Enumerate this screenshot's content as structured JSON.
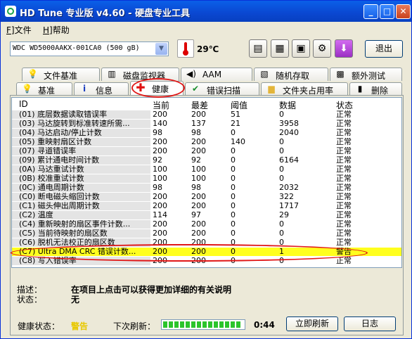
{
  "window": {
    "title": "HD Tune 专业版 v4.60 - 硬盘专业工具"
  },
  "menu": [
    {
      "label": "文件"
    },
    {
      "label": "帮助"
    }
  ],
  "toolbar": {
    "drive": "WDC WD5000AAKX-001CA0 (500 gB)",
    "temperature": "29℃",
    "exit_label": "退出"
  },
  "tabs_row1": [
    {
      "label": "文件基准",
      "icon": "light-bulb-doc-icon"
    },
    {
      "label": "磁盘监视器",
      "icon": "bar-chart-icon"
    },
    {
      "label": "AAM",
      "icon": "speaker-icon"
    },
    {
      "label": "随机存取",
      "icon": "random-access-icon"
    },
    {
      "label": "额外测试",
      "icon": "extra-tests-icon"
    }
  ],
  "tabs_row2": [
    {
      "label": "基准",
      "icon": "bulb-icon"
    },
    {
      "label": "信息",
      "icon": "info-icon"
    },
    {
      "label": "健康",
      "icon": "health-cross-icon"
    },
    {
      "label": "错误扫描",
      "icon": "check-icon"
    },
    {
      "label": "文件夹占用率",
      "icon": "folder-icon"
    },
    {
      "label": "删除",
      "icon": "trash-icon"
    }
  ],
  "smart_table": {
    "columns": [
      "ID",
      "当前",
      "最差",
      "阈值",
      "数据",
      "状态"
    ],
    "rows": [
      {
        "id": "(01) 底层数据读取错误率",
        "current": "200",
        "worst": "200",
        "threshold": "51",
        "data": "0",
        "status": "正常"
      },
      {
        "id": "(03) 马达旋转到标准转速所需...",
        "current": "140",
        "worst": "137",
        "threshold": "21",
        "data": "3958",
        "status": "正常"
      },
      {
        "id": "(04) 马达启动/停止计数",
        "current": "98",
        "worst": "98",
        "threshold": "0",
        "data": "2040",
        "status": "正常"
      },
      {
        "id": "(05) 重映射扇区计数",
        "current": "200",
        "worst": "200",
        "threshold": "140",
        "data": "0",
        "status": "正常"
      },
      {
        "id": "(07) 寻道错误率",
        "current": "200",
        "worst": "200",
        "threshold": "0",
        "data": "0",
        "status": "正常"
      },
      {
        "id": "(09) 累计通电时间计数",
        "current": "92",
        "worst": "92",
        "threshold": "0",
        "data": "6164",
        "status": "正常"
      },
      {
        "id": "(0A) 马达重试计数",
        "current": "100",
        "worst": "100",
        "threshold": "0",
        "data": "0",
        "status": "正常"
      },
      {
        "id": "(0B) 校准重试计数",
        "current": "100",
        "worst": "100",
        "threshold": "0",
        "data": "0",
        "status": "正常"
      },
      {
        "id": "(0C) 通电周期计数",
        "current": "98",
        "worst": "98",
        "threshold": "0",
        "data": "2032",
        "status": "正常"
      },
      {
        "id": "(C0) 断电磁头缩回计数",
        "current": "200",
        "worst": "200",
        "threshold": "0",
        "data": "322",
        "status": "正常"
      },
      {
        "id": "(C1) 磁头伸出周期计数",
        "current": "200",
        "worst": "200",
        "threshold": "0",
        "data": "1717",
        "status": "正常"
      },
      {
        "id": "(C2) 温度",
        "current": "114",
        "worst": "97",
        "threshold": "0",
        "data": "29",
        "status": "正常"
      },
      {
        "id": "(C4) 重新映射的扇区事件计数...",
        "current": "200",
        "worst": "200",
        "threshold": "0",
        "data": "0",
        "status": "正常"
      },
      {
        "id": "(C5) 当前待映射的扇区数",
        "current": "200",
        "worst": "200",
        "threshold": "0",
        "data": "0",
        "status": "正常"
      },
      {
        "id": "(C6) 脱机无法校正的扇区数",
        "current": "200",
        "worst": "200",
        "threshold": "0",
        "data": "0",
        "status": "正常"
      },
      {
        "id": "(C7) Ultra DMA CRC 错误计数...",
        "current": "200",
        "worst": "200",
        "threshold": "0",
        "data": "1",
        "status": "警告"
      },
      {
        "id": "(C8) 写入错误率",
        "current": "200",
        "worst": "200",
        "threshold": "0",
        "data": "0",
        "status": "正常"
      }
    ]
  },
  "details": {
    "desc_label": "描述：",
    "desc_value": "在项目上点击可以获得更加详细的有关说明",
    "status_label": "状态：",
    "status_value": "无"
  },
  "statusbar": {
    "health_label": "健康状态：",
    "health_value": "警告",
    "refresh_label": "下次刷新：",
    "countdown": "0:44",
    "refresh_progress": 0.97,
    "refresh_button": "立即刷新",
    "log_button": "日志"
  },
  "colors": {
    "title_bar": "#0a4fd8",
    "warning_row": "#ffff1e",
    "health_warning_text": "#e8c800",
    "highlight_ring": "#e01818"
  }
}
